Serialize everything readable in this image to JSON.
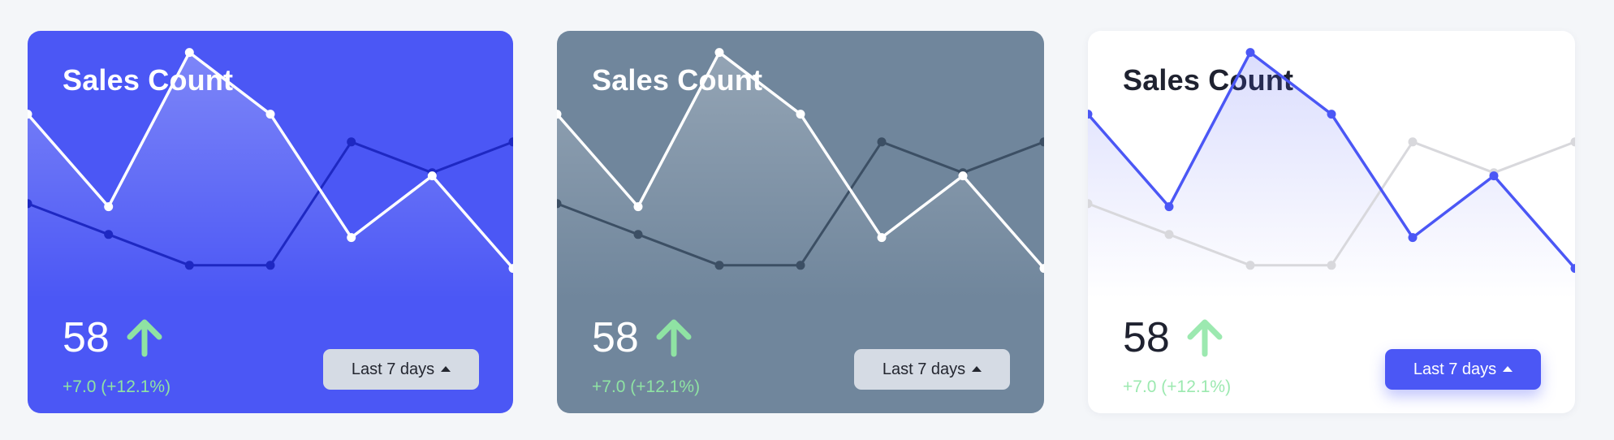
{
  "cards": [
    {
      "title": "Sales Count",
      "value": "58",
      "trend_icon": "arrow-up-icon",
      "delta": "+7.0 (+12.1%)",
      "range_label": "Last 7 days",
      "caret_icon": "caret-up-icon",
      "colors": {
        "background": "#4b57f5",
        "primary_line": "#ffffff",
        "secondary_line": "#1e28c2",
        "fill": "#ffffff",
        "fill_opacity": 0.28
      }
    },
    {
      "title": "Sales Count",
      "value": "58",
      "trend_icon": "arrow-up-icon",
      "delta": "+7.0 (+12.1%)",
      "range_label": "Last 7 days",
      "caret_icon": "caret-up-icon",
      "colors": {
        "background": "#70869c",
        "primary_line": "#ffffff",
        "secondary_line": "#3c4f64",
        "fill": "#ffffff",
        "fill_opacity": 0.25
      }
    },
    {
      "title": "Sales Count",
      "value": "58",
      "trend_icon": "arrow-up-icon",
      "delta": "+7.0 (+12.1%)",
      "range_label": "Last 7 days",
      "caret_icon": "caret-up-icon",
      "colors": {
        "background": "#ffffff",
        "primary_line": "#4b57f5",
        "secondary_line": "#d8d8dc",
        "fill": "#4b57f5",
        "fill_opacity": 0.2
      }
    }
  ],
  "chart_data": {
    "type": "line",
    "ylim": [
      0,
      10
    ],
    "grid": false,
    "series": [
      {
        "values": [
          7.3,
          4.3,
          9.3,
          7.3,
          3.3,
          5.3,
          2.3
        ]
      },
      {
        "values": [
          4.4,
          3.4,
          2.4,
          2.4,
          6.4,
          5.4,
          6.4
        ]
      }
    ]
  },
  "colors": {
    "page_background": "#f4f6f9",
    "trend_up": "#8fe3a3"
  }
}
